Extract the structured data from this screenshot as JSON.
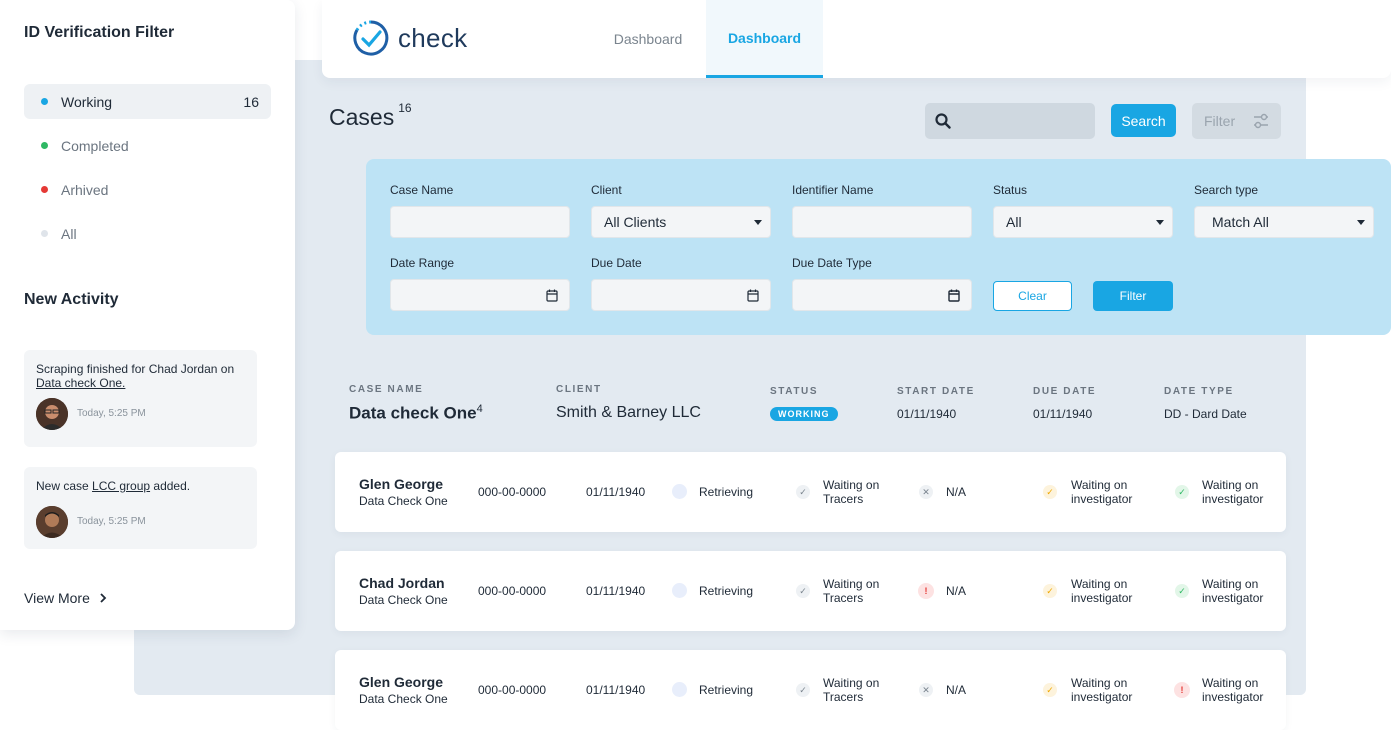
{
  "sidebar": {
    "title": "ID Verification Filter",
    "filters": [
      {
        "label": "Working",
        "count": "16",
        "color": "#19a6e3"
      },
      {
        "label": "Completed",
        "count": "",
        "color": "#2fb864"
      },
      {
        "label": "Arhived",
        "count": "",
        "color": "#e53935"
      },
      {
        "label": "All",
        "count": "",
        "color": "#dfe4ea"
      }
    ],
    "activity_title": "New Activity",
    "activities": [
      {
        "text": "Scraping finished for Chad Jordan on ",
        "link": "Data check One.",
        "after": "",
        "time": "Today, 5:25 PM"
      },
      {
        "text": "New case ",
        "link": "LCC group",
        "after": " added.",
        "time": "Today, 5:25 PM"
      }
    ],
    "view_more": "View More"
  },
  "header": {
    "logo_text": "check",
    "tabs": [
      "Dashboard",
      "Dashboard"
    ]
  },
  "cases": {
    "title": "Cases",
    "count": "16"
  },
  "toolbar": {
    "search_label": "Search",
    "filter_label": "Filter"
  },
  "filter_panel": {
    "case_name_label": "Case Name",
    "client_label": "Client",
    "client_value": "All Clients",
    "identifier_label": "Identifier Name",
    "status_label": "Status",
    "status_value": "All",
    "search_type_label": "Search type",
    "search_type_value": "Match All",
    "date_range_label": "Date Range",
    "due_date_label": "Due Date",
    "due_date_type_label": "Due Date Type",
    "clear_label": "Clear",
    "filter_label": "Filter"
  },
  "case_header": {
    "labels": {
      "case_name": "CASE NAME",
      "client": "CLIENT",
      "status": "STATUS",
      "start_date": "START DATE",
      "due_date": "DUE DATE",
      "date_type": "DATE TYPE"
    },
    "case_name": "Data check One",
    "case_count": "4",
    "client": "Smith & Barney LLC",
    "status": "WORKING",
    "start_date": "01/11/1940",
    "due_date": "01/11/1940",
    "date_type": "DD - Dard Date"
  },
  "rows": [
    {
      "name": "Glen George",
      "sub": "Data Check One",
      "ssn": "000-00-0000",
      "date": "01/11/1940",
      "retrieving": "Retrieving",
      "tracers": [
        "Waiting on",
        "Tracers"
      ],
      "na": "N/A",
      "na_icon": "x",
      "inv1": [
        "Waiting on",
        "investigator"
      ],
      "inv2": [
        "Waiting on",
        "investigator"
      ],
      "inv2_icon": "check"
    },
    {
      "name": "Chad Jordan",
      "sub": "Data Check One",
      "ssn": "000-00-0000",
      "date": "01/11/1940",
      "retrieving": "Retrieving",
      "tracers": [
        "Waiting on",
        "Tracers"
      ],
      "na": "N/A",
      "na_icon": "alert",
      "inv1": [
        "Waiting on",
        "investigator"
      ],
      "inv2": [
        "Waiting on",
        "investigator"
      ],
      "inv2_icon": "check"
    },
    {
      "name": "Glen George",
      "sub": "Data Check One",
      "ssn": "000-00-0000",
      "date": "01/11/1940",
      "retrieving": "Retrieving",
      "tracers": [
        "Waiting on",
        "Tracers"
      ],
      "na": "N/A",
      "na_icon": "x",
      "inv1": [
        "Waiting on",
        "investigator"
      ],
      "inv2": [
        "Waiting on",
        "investigator"
      ],
      "inv2_icon": "alert"
    }
  ],
  "colors": {
    "accent": "#19a6e3",
    "panel": "#bde3f5",
    "background": "#e3eaf1"
  }
}
